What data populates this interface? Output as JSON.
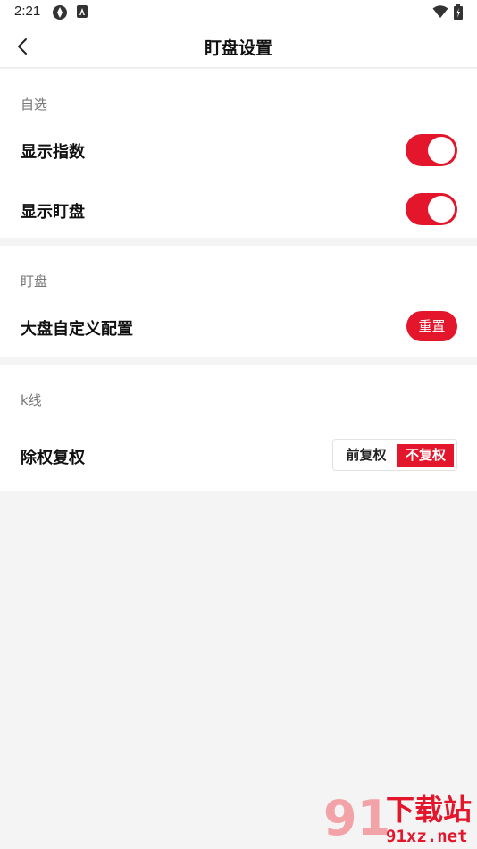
{
  "status_bar": {
    "time": "2:21",
    "icons": [
      "app-notification-icon",
      "accessibility-icon",
      "wifi-icon",
      "battery-icon"
    ]
  },
  "app_bar": {
    "back_icon": "chevron-left-icon",
    "title": "盯盘设置"
  },
  "sections": {
    "watchlist": {
      "label": "自选",
      "show_index": {
        "label": "显示指数",
        "enabled": true
      },
      "show_monitor": {
        "label": "显示盯盘",
        "enabled": true
      }
    },
    "monitor": {
      "label": "盯盘",
      "market_config": {
        "label": "大盘自定义配置",
        "button": "重置"
      }
    },
    "kline": {
      "label": "k线",
      "adjustment": {
        "label": "除权复权",
        "options": [
          "前复权",
          "不复权"
        ],
        "selected": "不复权"
      }
    }
  },
  "watermark": {
    "mark": "91",
    "line1": "下载站",
    "line2": "91xz.net"
  },
  "colors": {
    "accent": "#e3162b",
    "background": "#f4f4f4",
    "card": "#ffffff"
  }
}
